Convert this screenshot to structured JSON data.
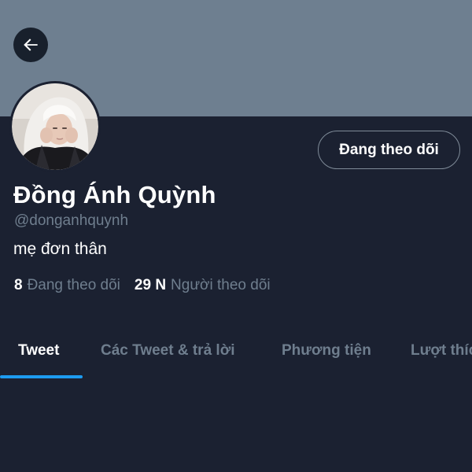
{
  "header": {
    "back_icon": "arrow-left-icon",
    "banner_color": "#6e7f90"
  },
  "profile": {
    "avatar_icon": "profile-photo",
    "follow_button_label": "Đang theo dõi",
    "display_name": "Đồng Ánh Quỳnh",
    "handle": "@donganhquynh",
    "bio": "mẹ đơn thân"
  },
  "stats": {
    "following_count": "8",
    "following_label": "Đang theo dõi",
    "followers_count": "29 N",
    "followers_label": "Người theo dõi"
  },
  "tabs": [
    {
      "label": "Tweet",
      "active": true
    },
    {
      "label": "Các Tweet & trả lời",
      "active": false
    },
    {
      "label": "Phương tiện",
      "active": false
    },
    {
      "label": "Lượt thích",
      "active": false
    }
  ],
  "colors": {
    "background": "#1b2131",
    "accent": "#1d9bf0",
    "muted_text": "#6f7e8e"
  }
}
